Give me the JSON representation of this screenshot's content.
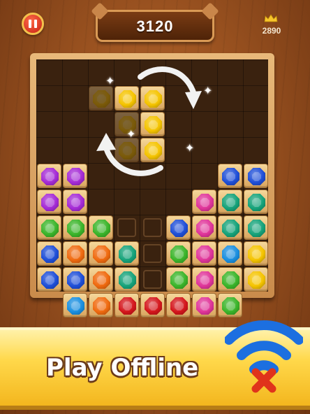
{
  "hud": {
    "score": "3120",
    "best_score": "2890",
    "pause_icon": "pause-icon",
    "crown_icon": "crown-icon"
  },
  "board": {
    "rows": 9,
    "cols": 9,
    "cells": [
      [
        6,
        0,
        "purple"
      ],
      [
        6,
        1,
        "purple"
      ],
      [
        6,
        7,
        "blue"
      ],
      [
        6,
        8,
        "blue"
      ],
      [
        7,
        0,
        "purple"
      ],
      [
        7,
        1,
        "purple"
      ],
      [
        7,
        6,
        "pink"
      ],
      [
        7,
        7,
        "teal"
      ],
      [
        7,
        8,
        "teal"
      ],
      [
        8,
        0,
        "green"
      ],
      [
        8,
        1,
        "green"
      ],
      [
        8,
        2,
        "green"
      ],
      [
        8,
        5,
        "blue"
      ],
      [
        8,
        6,
        "pink"
      ],
      [
        8,
        7,
        "teal"
      ],
      [
        8,
        8,
        "teal"
      ]
    ],
    "grid": [
      [
        null,
        null,
        null,
        null,
        null,
        null,
        null,
        null,
        null
      ],
      [
        null,
        null,
        null,
        null,
        null,
        null,
        null,
        null,
        null
      ],
      [
        null,
        null,
        null,
        null,
        null,
        null,
        null,
        null,
        null
      ],
      [
        null,
        null,
        null,
        null,
        null,
        null,
        null,
        null,
        null
      ],
      [
        "purple",
        "purple",
        null,
        null,
        null,
        null,
        null,
        "blue",
        "blue"
      ],
      [
        "purple",
        "purple",
        null,
        null,
        null,
        null,
        "pink",
        "teal",
        "teal"
      ],
      [
        "green",
        "green",
        "green",
        null,
        null,
        "blue",
        "pink",
        "teal",
        "teal"
      ],
      [
        "blue",
        "orange",
        "orange",
        "teal",
        null,
        "green",
        "pink",
        "sky",
        "yellow"
      ],
      [
        "blue",
        "blue",
        "orange",
        "teal",
        null,
        "green",
        "pink",
        "green",
        "yellow"
      ],
      [
        null,
        "sky",
        "orange",
        "red",
        "red",
        "red",
        "pink",
        "green",
        null
      ]
    ],
    "empty_outline_cells": [
      [
        6,
        3
      ],
      [
        6,
        4
      ],
      [
        7,
        4
      ],
      [
        8,
        4
      ]
    ],
    "piece_cells": [
      [
        1,
        3
      ],
      [
        1,
        4
      ],
      [
        2,
        4
      ],
      [
        3,
        4
      ]
    ],
    "piece_color": "yellow",
    "ghost_cells": [
      [
        1,
        2
      ],
      [
        2,
        3
      ],
      [
        3,
        3
      ]
    ]
  },
  "colors": {
    "purple": "#a52bd6",
    "blue": "#1f4fd8",
    "green": "#3bb52a",
    "teal": "#16a37a",
    "pink": "#e0359a",
    "orange": "#f06a0f",
    "yellow": "#f5c400",
    "red": "#d4161c",
    "sky": "#1a8fe0"
  },
  "banner": {
    "text": "Play Offline",
    "icon": "wifi-off-icon"
  }
}
